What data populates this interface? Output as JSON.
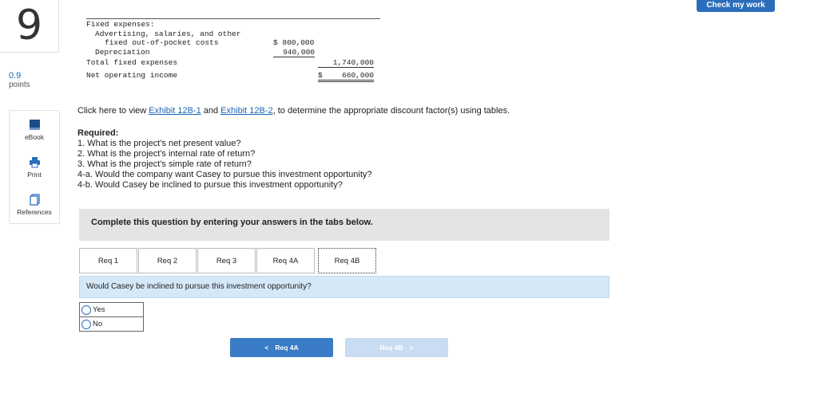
{
  "question": {
    "number": "9",
    "points_value": "0.9",
    "points_label": "points"
  },
  "header": {
    "check_my_work": "Check my work"
  },
  "tools": [
    {
      "label": "eBook",
      "icon": "book-icon"
    },
    {
      "label": "Print",
      "icon": "printer-icon"
    },
    {
      "label": "References",
      "icon": "references-icon"
    }
  ],
  "income_statement": {
    "fixed_expenses_label": "Fixed expenses:",
    "advertising_label_1": "Advertising, salaries, and other",
    "advertising_label_2": "fixed out-of-pocket costs",
    "advertising_value": "$ 800,000",
    "depreciation_label": "Depreciation",
    "depreciation_value": "940,000",
    "total_fixed_label": "Total fixed expenses",
    "total_fixed_value": "1,740,000",
    "noi_label": "Net operating income",
    "noi_currency": "$",
    "noi_value": "660,000"
  },
  "instructions": {
    "prefix": "Click here to view ",
    "exhibit_1": "Exhibit 12B-1",
    "and": " and ",
    "exhibit_2": "Exhibit 12B-2",
    "suffix": ", to determine the appropriate discount factor(s) using tables."
  },
  "required": {
    "title": "Required:",
    "items": [
      "1. What is the project's net present value?",
      "2. What is the project's internal rate of return?",
      "3. What is the project's simple rate of return?",
      "4-a. Would the company want Casey to pursue this investment opportunity?",
      "4-b. Would Casey be inclined to pursue this investment opportunity?"
    ]
  },
  "banner": "Complete this question by entering your answers in the tabs below.",
  "tabs": [
    {
      "label": "Req 1"
    },
    {
      "label": "Req 2"
    },
    {
      "label": "Req 3"
    },
    {
      "label": "Req 4A"
    },
    {
      "label": "Req 4B",
      "active": true
    }
  ],
  "current_question": "Would Casey be inclined to pursue this investment opportunity?",
  "options": [
    "Yes",
    "No"
  ],
  "navigation": {
    "prev_label": "Req 4A",
    "next_label": "Req 4B"
  },
  "colors": {
    "accent": "#2a6ebb",
    "question_bg": "#d5e8f8",
    "banner_bg": "#e4e4e4",
    "next_disabled": "#c9dcf1"
  }
}
